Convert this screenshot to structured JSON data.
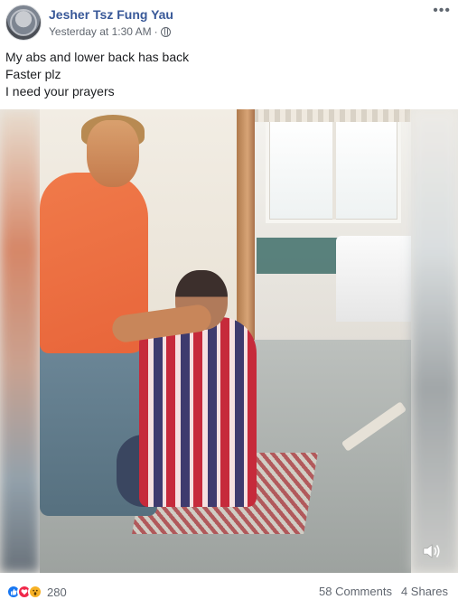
{
  "post": {
    "author": "Jesher Tsz Fung Yau",
    "timestamp": "Yesterday at 1:30 AM",
    "separator": "·",
    "privacy_icon": "globe-icon",
    "more_icon": "more-options-icon",
    "more_label": "•••",
    "lines": [
      "My abs and lower back has back",
      "Faster plz",
      "I need your prayers"
    ]
  },
  "video": {
    "volume_icon": "volume-icon"
  },
  "footer": {
    "reaction_icons": [
      "like-icon",
      "love-icon",
      "wow-icon"
    ],
    "reaction_count": "280",
    "comments": "58 Comments",
    "shares": "4 Shares"
  },
  "colors": {
    "author_link": "#385898",
    "meta_text": "#616770",
    "like": "#1877f2",
    "love": "#f0284a",
    "wow": "#f7b125"
  }
}
